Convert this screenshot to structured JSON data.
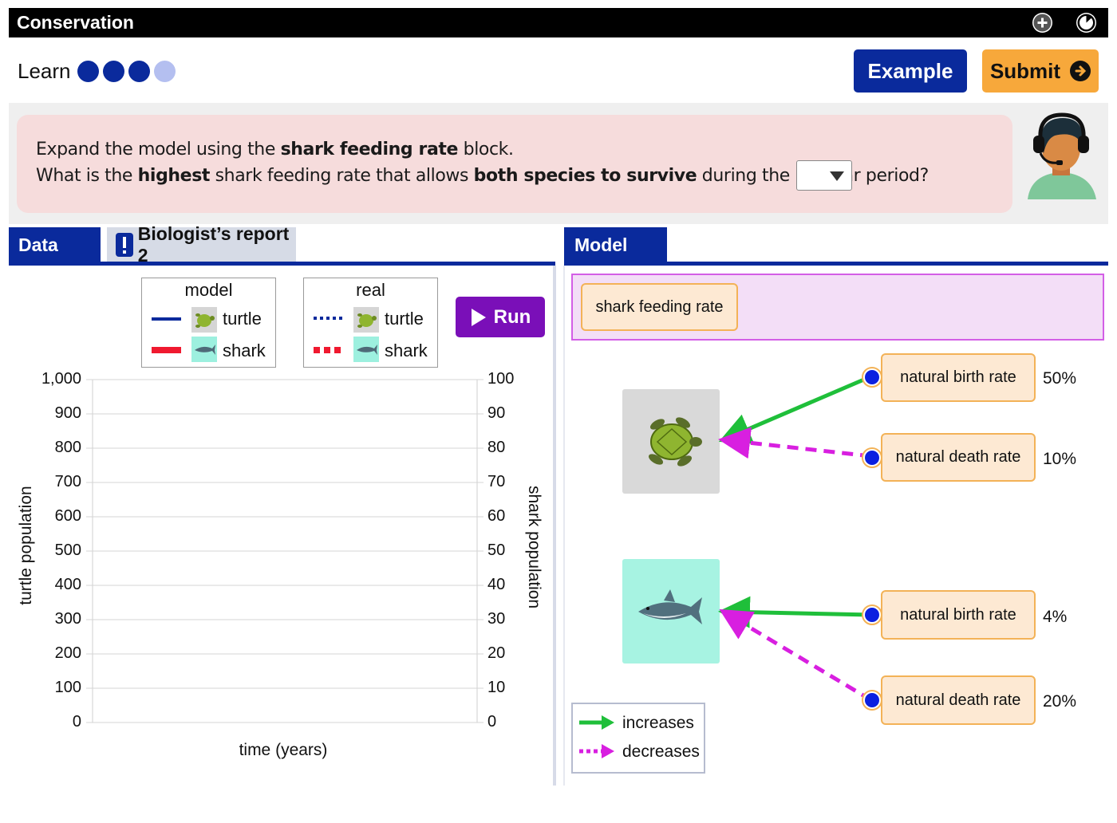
{
  "app": {
    "title": "Conservation"
  },
  "progress": {
    "label": "Learn",
    "steps_total": 4,
    "steps_done": 3
  },
  "header": {
    "example_label": "Example",
    "submit_label": "Submit"
  },
  "prompt": {
    "l1_a": "Expand the model using the ",
    "l1_b": "shark feeding rate",
    "l1_c": " block.",
    "l2_a": "What is the ",
    "l2_b": "highest",
    "l2_c": " shark feeding rate that allows ",
    "l2_d": "both species to survive",
    "l2_e": " during the 10-year period?",
    "answer_value": ""
  },
  "tabs": {
    "data": "Data",
    "report": "Biologist’s report 2",
    "model": "Model"
  },
  "legend": {
    "model_title": "model",
    "real_title": "real",
    "turtle": "turtle",
    "shark": "shark",
    "run_label": "Run"
  },
  "chart_data": {
    "type": "line",
    "title": "",
    "xlabel": "time (years)",
    "ylabel": "turtle population",
    "y2label": "shark population",
    "ylim": [
      0,
      1000
    ],
    "y2lim": [
      0,
      100
    ],
    "yticks": [
      "1,000",
      "900",
      "800",
      "700",
      "600",
      "500",
      "400",
      "300",
      "200",
      "100",
      "0"
    ],
    "y2ticks": [
      "100",
      "90",
      "80",
      "70",
      "60",
      "50",
      "40",
      "30",
      "20",
      "10",
      "0"
    ],
    "series": [],
    "legend_position": "top",
    "colors": {
      "turtle_model": "#0a2a9c",
      "shark_model": "#f0192f",
      "turtle_real": "#0a2a9c",
      "shark_real": "#f0192f"
    }
  },
  "model": {
    "feeding_block": "shark feeding rate",
    "turtle_birth": {
      "label": "natural birth rate",
      "value": "50%"
    },
    "turtle_death": {
      "label": "natural death rate",
      "value": "10%"
    },
    "shark_birth": {
      "label": "natural birth rate",
      "value": "4%"
    },
    "shark_death": {
      "label": "natural death rate",
      "value": "20%"
    },
    "legend_increases": "increases",
    "legend_decreases": "decreases",
    "colors": {
      "increases": "#1fbf3a",
      "decreases": "#d81fe0"
    }
  }
}
